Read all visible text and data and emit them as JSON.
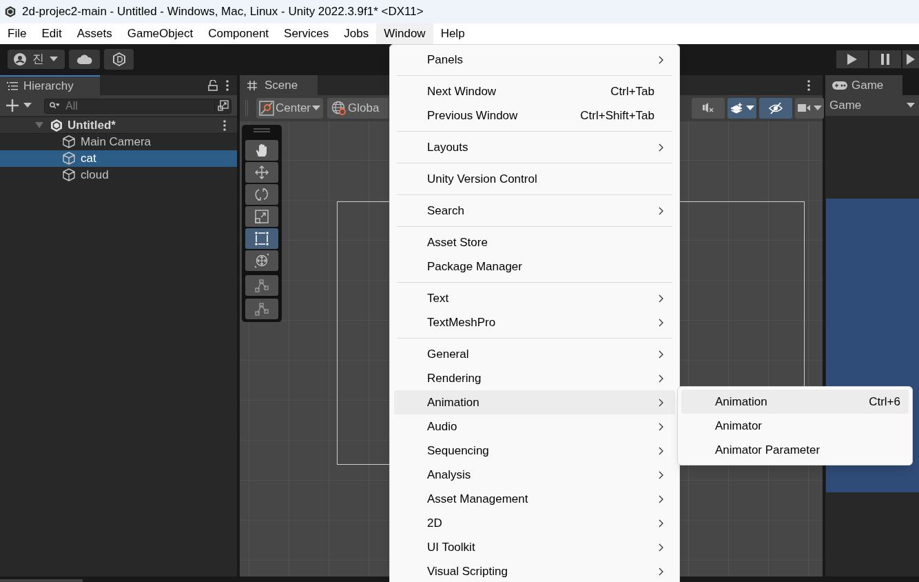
{
  "window": {
    "title": "2d-projec2-main - Untitled - Windows, Mac, Linux - Unity 2022.3.9f1* <DX11>"
  },
  "menu_bar": [
    {
      "label": "File",
      "selected": false
    },
    {
      "label": "Edit",
      "selected": false
    },
    {
      "label": "Assets",
      "selected": false
    },
    {
      "label": "GameObject",
      "selected": false
    },
    {
      "label": "Component",
      "selected": false
    },
    {
      "label": "Services",
      "selected": false
    },
    {
      "label": "Jobs",
      "selected": false
    },
    {
      "label": "Window",
      "selected": true
    },
    {
      "label": "Help",
      "selected": false
    }
  ],
  "toolbar": {
    "account": "진"
  },
  "hierarchy": {
    "tab": "Hierarchy",
    "search": {
      "placeholder": "All"
    },
    "scene": "Untitled*",
    "items": [
      {
        "label": "Main Camera",
        "selected": false
      },
      {
        "label": "cat",
        "selected": true
      },
      {
        "label": "cloud",
        "selected": false
      }
    ]
  },
  "scene": {
    "tab": "Scene",
    "pivot": "Center",
    "handle": "Globa",
    "tools": [
      {
        "kind": "hand",
        "selected": false
      },
      {
        "kind": "move",
        "selected": false
      },
      {
        "kind": "rotate",
        "selected": false
      },
      {
        "kind": "scale",
        "selected": false
      },
      {
        "kind": "rect",
        "selected": true
      },
      {
        "kind": "transform",
        "selected": false
      },
      {
        "kind": "path",
        "selected": false
      },
      {
        "kind": "path",
        "selected": false
      }
    ],
    "toggles": [
      {
        "kind": "mute",
        "selected": false
      },
      {
        "kind": "effects",
        "selected": true
      },
      {
        "kind": "visibility",
        "selected": true
      },
      {
        "kind": "camera",
        "selected": false
      }
    ]
  },
  "game": {
    "tab": "Game",
    "display": "Game"
  },
  "window_menu": {
    "groups": [
      [
        {
          "label": "Panels",
          "submenu": true,
          "selected": false
        }
      ],
      [
        {
          "label": "Next Window",
          "shortcut": "Ctrl+Tab",
          "submenu": false,
          "selected": false
        },
        {
          "label": "Previous Window",
          "shortcut": "Ctrl+Shift+Tab",
          "submenu": false,
          "selected": false
        }
      ],
      [
        {
          "label": "Layouts",
          "submenu": true,
          "selected": false
        }
      ],
      [
        {
          "label": "Unity Version Control",
          "submenu": false,
          "selected": false
        }
      ],
      [
        {
          "label": "Search",
          "submenu": true,
          "selected": false
        }
      ],
      [
        {
          "label": "Asset Store",
          "submenu": false,
          "selected": false
        },
        {
          "label": "Package Manager",
          "submenu": false,
          "selected": false
        }
      ],
      [
        {
          "label": "Text",
          "submenu": true,
          "selected": false
        },
        {
          "label": "TextMeshPro",
          "submenu": true,
          "selected": false
        }
      ],
      [
        {
          "label": "General",
          "submenu": true,
          "selected": false
        },
        {
          "label": "Rendering",
          "submenu": true,
          "selected": false
        },
        {
          "label": "Animation",
          "submenu": true,
          "selected": true
        },
        {
          "label": "Audio",
          "submenu": true,
          "selected": false
        },
        {
          "label": "Sequencing",
          "submenu": true,
          "selected": false
        },
        {
          "label": "Analysis",
          "submenu": true,
          "selected": false
        },
        {
          "label": "Asset Management",
          "submenu": true,
          "selected": false
        },
        {
          "label": "2D",
          "submenu": true,
          "selected": false
        },
        {
          "label": "UI Toolkit",
          "submenu": true,
          "selected": false
        },
        {
          "label": "Visual Scripting",
          "submenu": true,
          "selected": false
        }
      ]
    ]
  },
  "submenu": {
    "items": [
      {
        "label": "Animation",
        "shortcut": "Ctrl+6",
        "selected": true
      },
      {
        "label": "Animator",
        "selected": false
      },
      {
        "label": "Animator Parameter",
        "selected": false
      }
    ]
  }
}
